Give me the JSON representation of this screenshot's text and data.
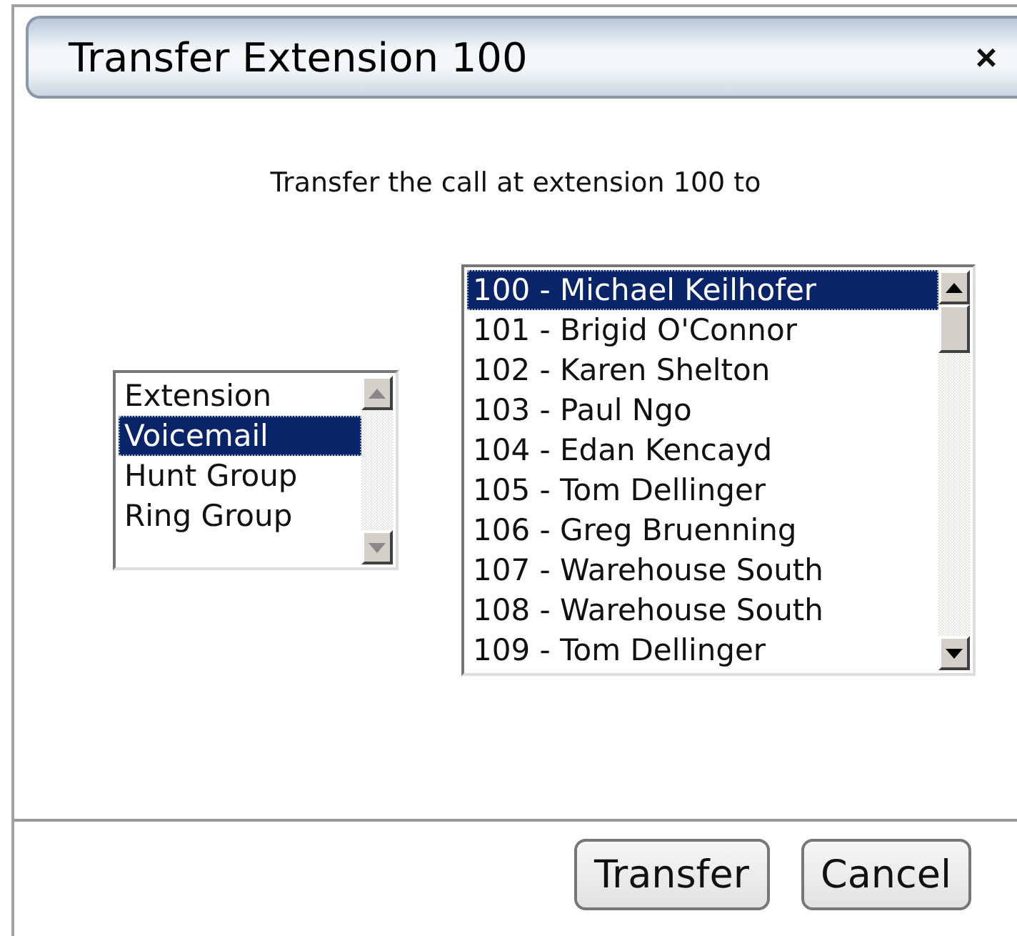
{
  "window": {
    "title": "Transfer Extension 100",
    "close": "×"
  },
  "prompt": "Transfer the call at extension 100 to",
  "destination_types": [
    {
      "label": "Extension",
      "selected": false
    },
    {
      "label": "Voicemail",
      "selected": true
    },
    {
      "label": "Hunt Group",
      "selected": false
    },
    {
      "label": "Ring Group",
      "selected": false
    }
  ],
  "extensions": [
    {
      "label": "100 - Michael Keilhofer",
      "selected": true
    },
    {
      "label": "101 - Brigid O'Connor",
      "selected": false
    },
    {
      "label": "102 - Karen Shelton",
      "selected": false
    },
    {
      "label": "103 - Paul Ngo",
      "selected": false
    },
    {
      "label": "104 - Edan Kencayd",
      "selected": false
    },
    {
      "label": "105 - Tom Dellinger",
      "selected": false
    },
    {
      "label": "106 - Greg Bruenning",
      "selected": false
    },
    {
      "label": "107 - Warehouse South",
      "selected": false
    },
    {
      "label": "108 - Warehouse South",
      "selected": false
    },
    {
      "label": "109 - Tom Dellinger",
      "selected": false
    }
  ],
  "buttons": [
    "Transfer",
    "Cancel"
  ]
}
